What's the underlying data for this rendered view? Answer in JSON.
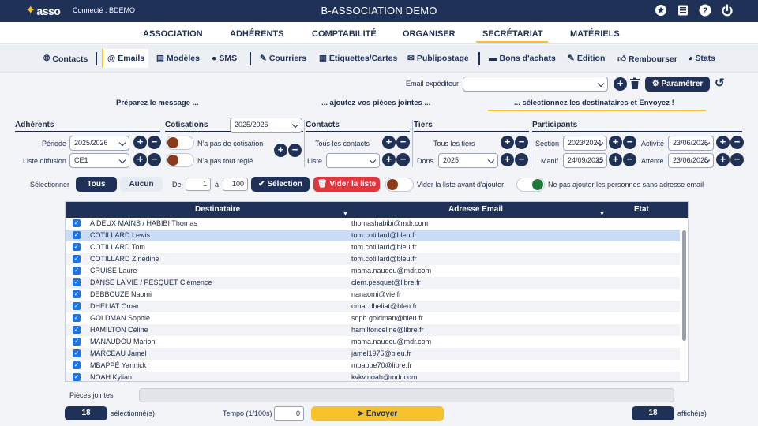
{
  "topbar": {
    "logo_text": "asso",
    "connected": "Connecté : BDEMO",
    "title": "B-ASSOCIATION DEMO",
    "icons": [
      "star-icon",
      "book-icon",
      "help-icon",
      "power-icon"
    ]
  },
  "main_nav": [
    "ASSOCIATION",
    "ADHÉRENTS",
    "COMPTABILITÉ",
    "ORGANISER",
    "SECRÉTARIAT",
    "MATÉRIELS"
  ],
  "main_nav_active": "SECRÉTARIAT",
  "sub_nav": [
    "Contacts",
    "Emails",
    "Modèles",
    "SMS",
    "Courriers",
    "Étiquettes/Cartes",
    "Publipostage",
    "Bons d'achats",
    "Édition",
    "Rembourser",
    "Stats"
  ],
  "sub_nav_active": "Emails",
  "sender": {
    "label": "Email expéditeur",
    "value": "",
    "configure_label": "Paramétrer"
  },
  "steps": [
    "Préparez le message ...",
    "... ajoutez vos pièces jointes ...",
    "... sélectionnez les destinataires et Envoyez !"
  ],
  "filters": {
    "adherents": {
      "title": "Adhérents",
      "periode_label": "Période",
      "periode_value": "2025/2026",
      "liste_label": "Liste diffusion",
      "liste_value": "CE1"
    },
    "cotisations": {
      "title": "Cotisations",
      "period_value": "2025/2026",
      "no_cotisation": "N'a pas de cotisation",
      "not_paid": "N'a pas tout réglé"
    },
    "contacts": {
      "title": "Contacts",
      "all_label": "Tous les contacts",
      "liste_label": "Liste",
      "liste_value": ""
    },
    "tiers": {
      "title": "Tiers",
      "all_label": "Tous les tiers",
      "dons_label": "Dons",
      "dons_value": "2025"
    },
    "participants": {
      "title": "Participants",
      "section_label": "Section",
      "section_value": "2023/2024",
      "activite_label": "Activité",
      "activite_value": "23/06/2025",
      "manif_label": "Manif.",
      "manif_value": "24/09/2025",
      "attente_label": "Attente",
      "attente_value": "23/06/2025"
    }
  },
  "selection": {
    "label": "Sélectionner",
    "all_label": "Tous",
    "none_label": "Aucun",
    "from_label": "De",
    "from_value": "1",
    "to_label": "à",
    "to_value": "100",
    "selection_button": "Sélection",
    "clear_button": "Vider la liste",
    "clear_before_label": "Vider la liste avant d'ajouter",
    "no_email_label": "Ne pas ajouter les personnes sans adresse email"
  },
  "table": {
    "columns": [
      "Destinataire",
      "Adresse Email",
      "Etat"
    ],
    "rows": [
      {
        "name": "A DEUX MAINS / HABIBI Thomas",
        "email": "thomashabibi@mdr.com"
      },
      {
        "name": "COTILLARD Lewis",
        "email": "tom.cotillard@bleu.fr"
      },
      {
        "name": "COTILLARD Tom",
        "email": "tom.cotillard@bleu.fr"
      },
      {
        "name": "COTILLARD Zinedine",
        "email": "tom.cotillard@bleu.fr"
      },
      {
        "name": "CRUISE Laure",
        "email": "mama.naudou@mdr.com"
      },
      {
        "name": "DANSE LA VIE / PESQUET Clémence",
        "email": "clem.pesquet@libre.fr"
      },
      {
        "name": "DEBBOUZE Naomi",
        "email": "nanaomi@vie.fr"
      },
      {
        "name": "DHELIAT Omar",
        "email": "omar.dheliat@bleu.fr"
      },
      {
        "name": "GOLDMAN Sophie",
        "email": "soph.goldman@bleu.fr"
      },
      {
        "name": "HAMILTON Céline",
        "email": "hamiltonceline@libre.fr"
      },
      {
        "name": "MANAUDOU Marion",
        "email": "mama.naudou@mdr.com"
      },
      {
        "name": "MARCEAU Jamel",
        "email": "jamel1975@bleu.fr"
      },
      {
        "name": "MBAPPÉ Yannick",
        "email": "mbappe70@libre.fr"
      },
      {
        "name": "NOAH Kylian",
        "email": "kvkv.noah@mdr.com"
      }
    ]
  },
  "footer": {
    "attachments_label": "Pièces jointes",
    "selected_count": "18",
    "selected_label": "sélectionné(s)",
    "tempo_label": "Tempo (1/100s)",
    "tempo_value": "0",
    "send_label": "Envoyer",
    "displayed_count": "18",
    "displayed_label": "affiché(s)"
  },
  "colors": {
    "navy": "#1f3157",
    "accent": "#f6c12e",
    "danger": "#e0373f",
    "selected_row": "#cbdcf5"
  }
}
